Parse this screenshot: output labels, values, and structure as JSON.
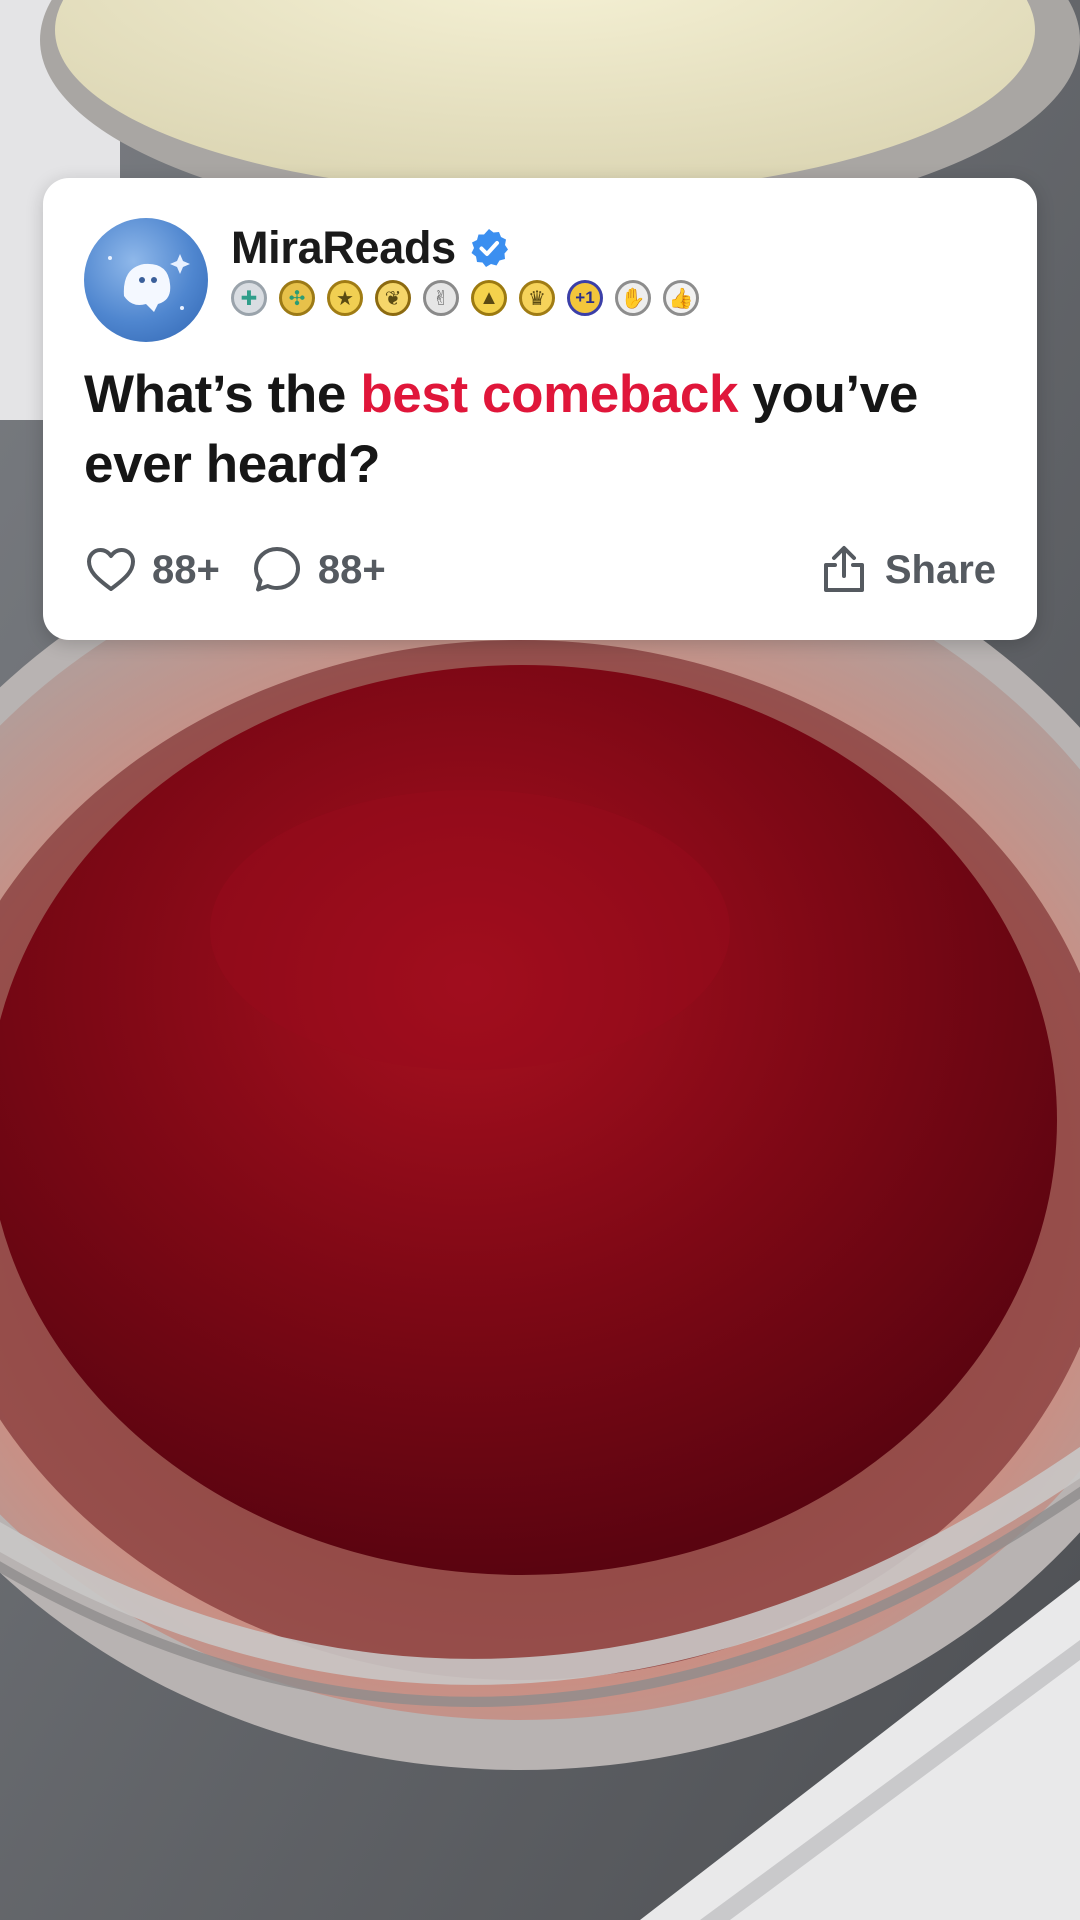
{
  "post": {
    "username": "MiraReads",
    "verified": true,
    "badges": [
      "badge-medal",
      "badge-clover",
      "badge-star",
      "badge-leaf",
      "badge-handshake",
      "badge-triangle",
      "badge-trophy",
      "badge-plus-one",
      "badge-clap",
      "badge-thumbs-up"
    ],
    "question_before": "What’s the ",
    "question_highlight": "best comeback",
    "question_after": " you’ve ever heard?",
    "likes": "88+",
    "comments": "88+",
    "share_label": "Share"
  },
  "colors": {
    "highlight": "#e0163a",
    "verified": "#3b8ff0",
    "card_bg": "#ffffff",
    "liquid": "#7a0a14"
  }
}
